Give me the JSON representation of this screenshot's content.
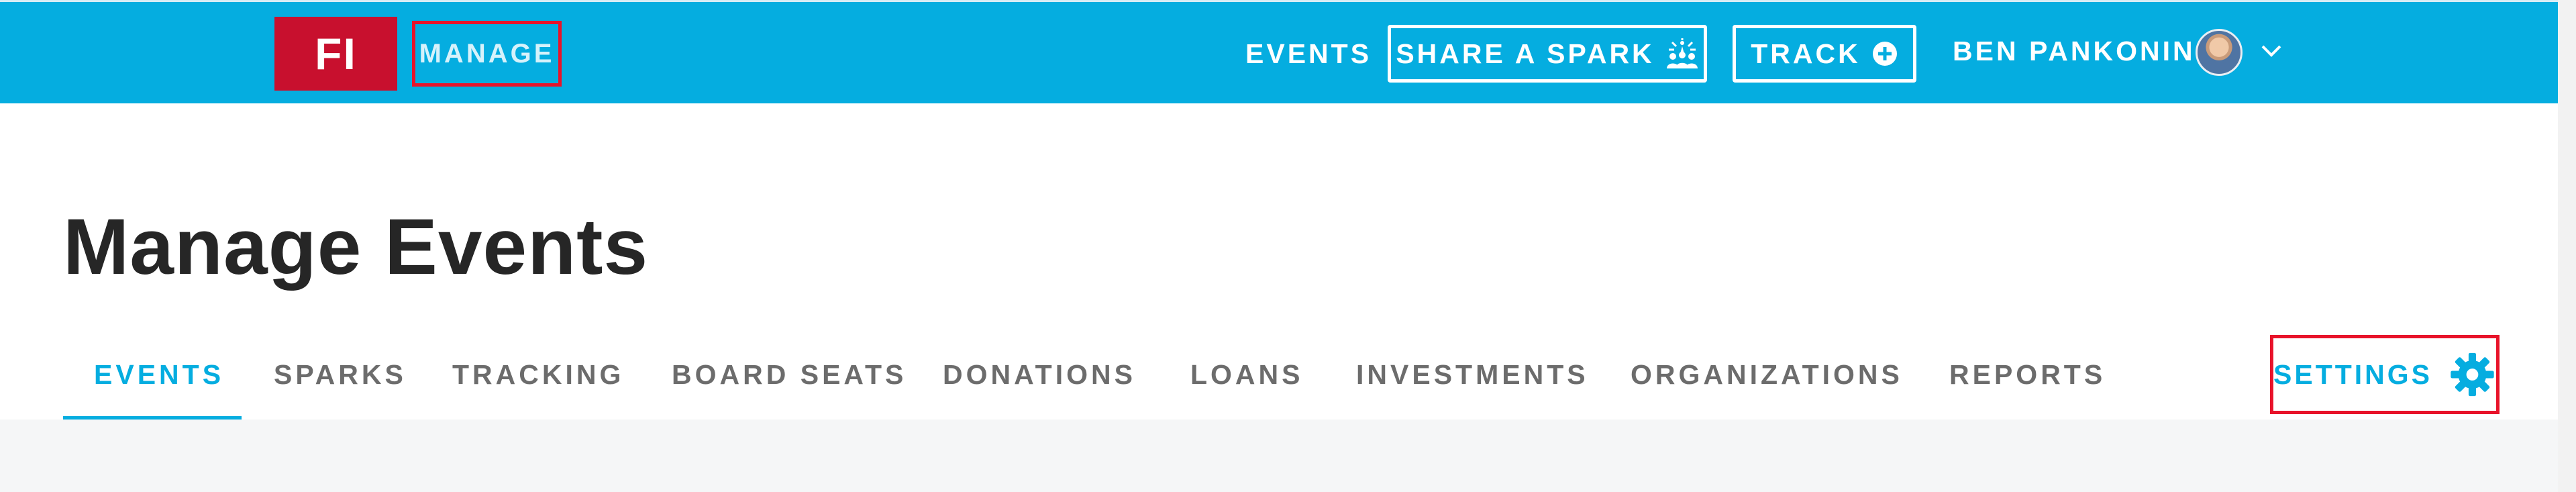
{
  "header": {
    "logo_text": "FI",
    "manage_label": "MANAGE",
    "nav_events": "EVENTS",
    "share_spark_label": "SHARE A SPARK",
    "track_label": "TRACK",
    "user_name": "BEN PANKONIN",
    "icons": {
      "share_spark": "spark-people-icon",
      "track": "plus-circle-icon",
      "user_menu": "chevron-down-icon",
      "avatar": "user-avatar"
    },
    "colors": {
      "brand_blue": "#05ade0",
      "logo_red": "#c8102e",
      "highlight_red": "#e8132a"
    }
  },
  "page": {
    "title": "Manage Events",
    "tabs": [
      {
        "label": "EVENTS",
        "active": true
      },
      {
        "label": "SPARKS",
        "active": false
      },
      {
        "label": "TRACKING",
        "active": false
      },
      {
        "label": "BOARD SEATS",
        "active": false
      },
      {
        "label": "DONATIONS",
        "active": false
      },
      {
        "label": "LOANS",
        "active": false
      },
      {
        "label": "INVESTMENTS",
        "active": false
      },
      {
        "label": "ORGANIZATIONS",
        "active": false
      },
      {
        "label": "REPORTS",
        "active": false
      }
    ],
    "settings_label": "SETTINGS",
    "settings_icon": "gear-icon"
  }
}
